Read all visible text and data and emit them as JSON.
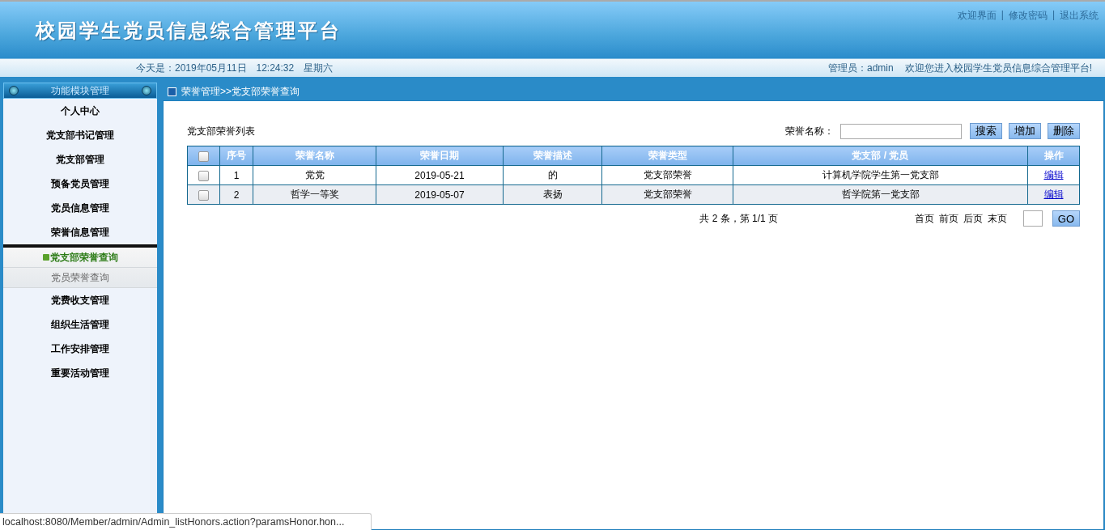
{
  "header": {
    "title": "校园学生党员信息综合管理平台",
    "links": [
      "欢迎界面",
      "修改密码",
      "退出系统"
    ],
    "separator": "|"
  },
  "info_bar": {
    "date": "今天是：2019年05月11日　12:24:32　星期六",
    "user": "管理员：admin",
    "welcome": "欢迎您进入校园学生党员信息综合管理平台!"
  },
  "sidebar": {
    "title": "功能模块管理",
    "items": [
      {
        "label": "个人中心"
      },
      {
        "label": "党支部书记管理"
      },
      {
        "label": "党支部管理"
      },
      {
        "label": "预备党员管理"
      },
      {
        "label": "党员信息管理"
      },
      {
        "label": "荣誉信息管理",
        "children": [
          {
            "label": "党支部荣誉查询",
            "selected": true
          },
          {
            "label": "党员荣誉查询",
            "selected": false
          }
        ]
      },
      {
        "label": "党费收支管理"
      },
      {
        "label": "组织生活管理"
      },
      {
        "label": "工作安排管理"
      },
      {
        "label": "重要活动管理"
      }
    ]
  },
  "breadcrumb": "荣誉管理>>党支部荣誉查询",
  "list": {
    "title": "党支部荣誉列表",
    "search_label": "荣誉名称：",
    "buttons": [
      "搜索",
      "增加",
      "删除"
    ],
    "table": {
      "header_checked": false,
      "columns": [
        "序号",
        "荣誉名称",
        "荣誉日期",
        "荣誉描述",
        "荣誉类型",
        "党支部 / 党员",
        "操作"
      ],
      "rows": [
        {
          "checked": false,
          "cells": [
            "1",
            "党党",
            "2019-05-21",
            "的",
            "党支部荣誉",
            "计算机学院学生第一党支部"
          ],
          "action": "编辑"
        },
        {
          "checked": false,
          "cells": [
            "2",
            "哲学一等奖",
            "2019-05-07",
            "表扬",
            "党支部荣誉",
            "哲学院第一党支部"
          ],
          "action": "编辑"
        }
      ]
    },
    "summary": "共 2 条，第 1/1 页",
    "pager": [
      "首页",
      "前页",
      "后页",
      "末页"
    ],
    "go": "GO"
  },
  "status_bar": "localhost:8080/Member/admin/Admin_listHonors.action?paramsHonor.hon..."
}
